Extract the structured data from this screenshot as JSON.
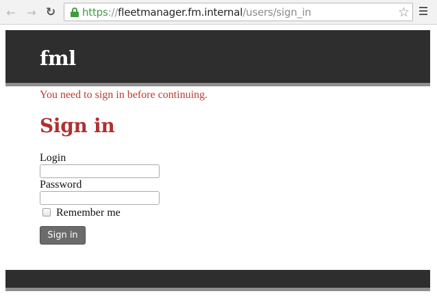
{
  "browser": {
    "url_scheme": "https",
    "url_separator": "://",
    "url_host": "fleetmanager.fm.internal",
    "url_path": "/users/sign_in",
    "back_icon": "arrow-left",
    "forward_icon": "arrow-right",
    "reload_icon": "reload",
    "bookmark_icon": "star",
    "menu_icon": "hamburger"
  },
  "header": {
    "brand": "fml"
  },
  "flash": {
    "alert": "You need to sign in before continuing."
  },
  "form": {
    "heading": "Sign in",
    "login_label": "Login",
    "login_value": "",
    "password_label": "Password",
    "password_value": "",
    "remember_label": "Remember me",
    "remember_checked": false,
    "submit_label": "Sign in"
  },
  "colors": {
    "header_bg": "#2e2e2e",
    "header_border": "#8f8f8f",
    "heading": "#b03030",
    "flash": "#c0392b",
    "button_bg": "#6b6b6b",
    "secure_green": "#3f9b3f"
  }
}
